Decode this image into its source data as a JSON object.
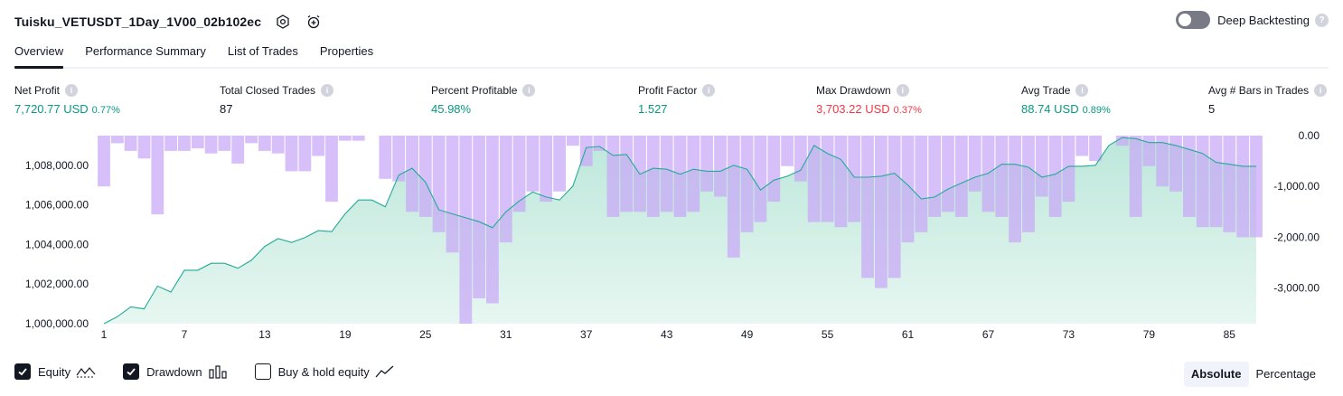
{
  "header": {
    "title": "Tuisku_VETUSDT_1Day_1V00_02b102ec",
    "icons": [
      "settings-hex-icon",
      "alarm-plus-icon"
    ],
    "deep_backtesting": {
      "label": "Deep Backtesting",
      "enabled": false
    }
  },
  "tabs": [
    {
      "label": "Overview",
      "active": true
    },
    {
      "label": "Performance Summary",
      "active": false
    },
    {
      "label": "List of Trades",
      "active": false
    },
    {
      "label": "Properties",
      "active": false
    }
  ],
  "metrics": [
    {
      "label": "Net Profit",
      "value": "7,720.77 USD",
      "pct": "0.77%",
      "color": "green"
    },
    {
      "label": "Total Closed Trades",
      "value": "87",
      "pct": "",
      "color": "dark"
    },
    {
      "label": "Percent Profitable",
      "value": "45.98%",
      "pct": "",
      "color": "green"
    },
    {
      "label": "Profit Factor",
      "value": "1.527",
      "pct": "",
      "color": "green"
    },
    {
      "label": "Max Drawdown",
      "value": "3,703.22 USD",
      "pct": "0.37%",
      "color": "red"
    },
    {
      "label": "Avg Trade",
      "value": "88.74 USD",
      "pct": "0.89%",
      "color": "green"
    },
    {
      "label": "Avg # Bars in Trades",
      "value": "5",
      "pct": "",
      "color": "dark"
    }
  ],
  "colors": {
    "equity_line": "#22ab94",
    "equity_fill": "#c4eadf",
    "drawdown_bar": "#c8a8f7",
    "green": "#089981",
    "red": "#f23645"
  },
  "chart_data": {
    "type": "area",
    "x_ticks": [
      "1",
      "7",
      "13",
      "19",
      "25",
      "31",
      "37",
      "43",
      "49",
      "55",
      "61",
      "67",
      "73",
      "79",
      "85"
    ],
    "left_axis_ticks": [
      "1,008,000.00",
      "1,006,000.00",
      "1,004,000.00",
      "1,002,000.00",
      "1,000,000.00"
    ],
    "right_axis_ticks": [
      "0.00",
      "-1,000.00",
      "-2,000.00",
      "-3,000.00"
    ],
    "left_ylim": [
      1000000,
      1009500
    ],
    "right_ylim": [
      -3700,
      0
    ],
    "series": [
      {
        "name": "Equity",
        "axis": "left",
        "values": [
          1000000,
          1000350,
          1000850,
          1000750,
          1001900,
          1001600,
          1002700,
          1002700,
          1003050,
          1003050,
          1002800,
          1003200,
          1003900,
          1004300,
          1004100,
          1004350,
          1004700,
          1004650,
          1005550,
          1006250,
          1006250,
          1005900,
          1007500,
          1007850,
          1007150,
          1005750,
          1005550,
          1005350,
          1005150,
          1004850,
          1005650,
          1006200,
          1006650,
          1006400,
          1006250,
          1006950,
          1008900,
          1008950,
          1008500,
          1008550,
          1007550,
          1007850,
          1007800,
          1007550,
          1007800,
          1007700,
          1007700,
          1008000,
          1007800,
          1006750,
          1007250,
          1007450,
          1007750,
          1009000,
          1008600,
          1008300,
          1007400,
          1007400,
          1007450,
          1007600,
          1007000,
          1006300,
          1006400,
          1006800,
          1007100,
          1007400,
          1007600,
          1008050,
          1008050,
          1007900,
          1007400,
          1007550,
          1007950,
          1007950,
          1008000,
          1009000,
          1009400,
          1009350,
          1009150,
          1009150,
          1009000,
          1008800,
          1008600,
          1008150,
          1008050,
          1007950,
          1007950
        ]
      },
      {
        "name": "Drawdown",
        "axis": "right",
        "values": [
          -1000,
          -150,
          -300,
          -450,
          -1550,
          -300,
          -300,
          -250,
          -350,
          -300,
          -550,
          -150,
          -300,
          -350,
          -700,
          -700,
          -400,
          -1300,
          -100,
          -100,
          0,
          -850,
          -900,
          -1500,
          -1600,
          -1900,
          -2300,
          -3700,
          -3200,
          -3300,
          -2100,
          -1500,
          -1100,
          -1300,
          -1100,
          -200,
          -600,
          -300,
          -1600,
          -1500,
          -1500,
          -1600,
          -1500,
          -1600,
          -1500,
          -1100,
          -1200,
          -2400,
          -1900,
          -1700,
          -1300,
          -600,
          -900,
          -1700,
          -1700,
          -1800,
          -1700,
          -2800,
          -3000,
          -2800,
          -2100,
          -1900,
          -1600,
          -1500,
          -1600,
          -1100,
          -1500,
          -1600,
          -2100,
          -1900,
          -1200,
          -1600,
          -1300,
          -400,
          -500,
          0,
          -200,
          -1600,
          -600,
          -1000,
          -1100,
          -1600,
          -1800,
          -1800,
          -1900,
          -2000,
          -2000
        ]
      }
    ]
  },
  "legend": [
    {
      "label": "Equity",
      "checked": true,
      "icon": "equity-line-icon"
    },
    {
      "label": "Drawdown",
      "checked": true,
      "icon": "drawdown-bars-icon"
    },
    {
      "label": "Buy & hold equity",
      "checked": false,
      "icon": "buy-hold-line-icon"
    }
  ],
  "scale": {
    "absolute": "Absolute",
    "percentage": "Percentage",
    "selected": "Absolute"
  }
}
